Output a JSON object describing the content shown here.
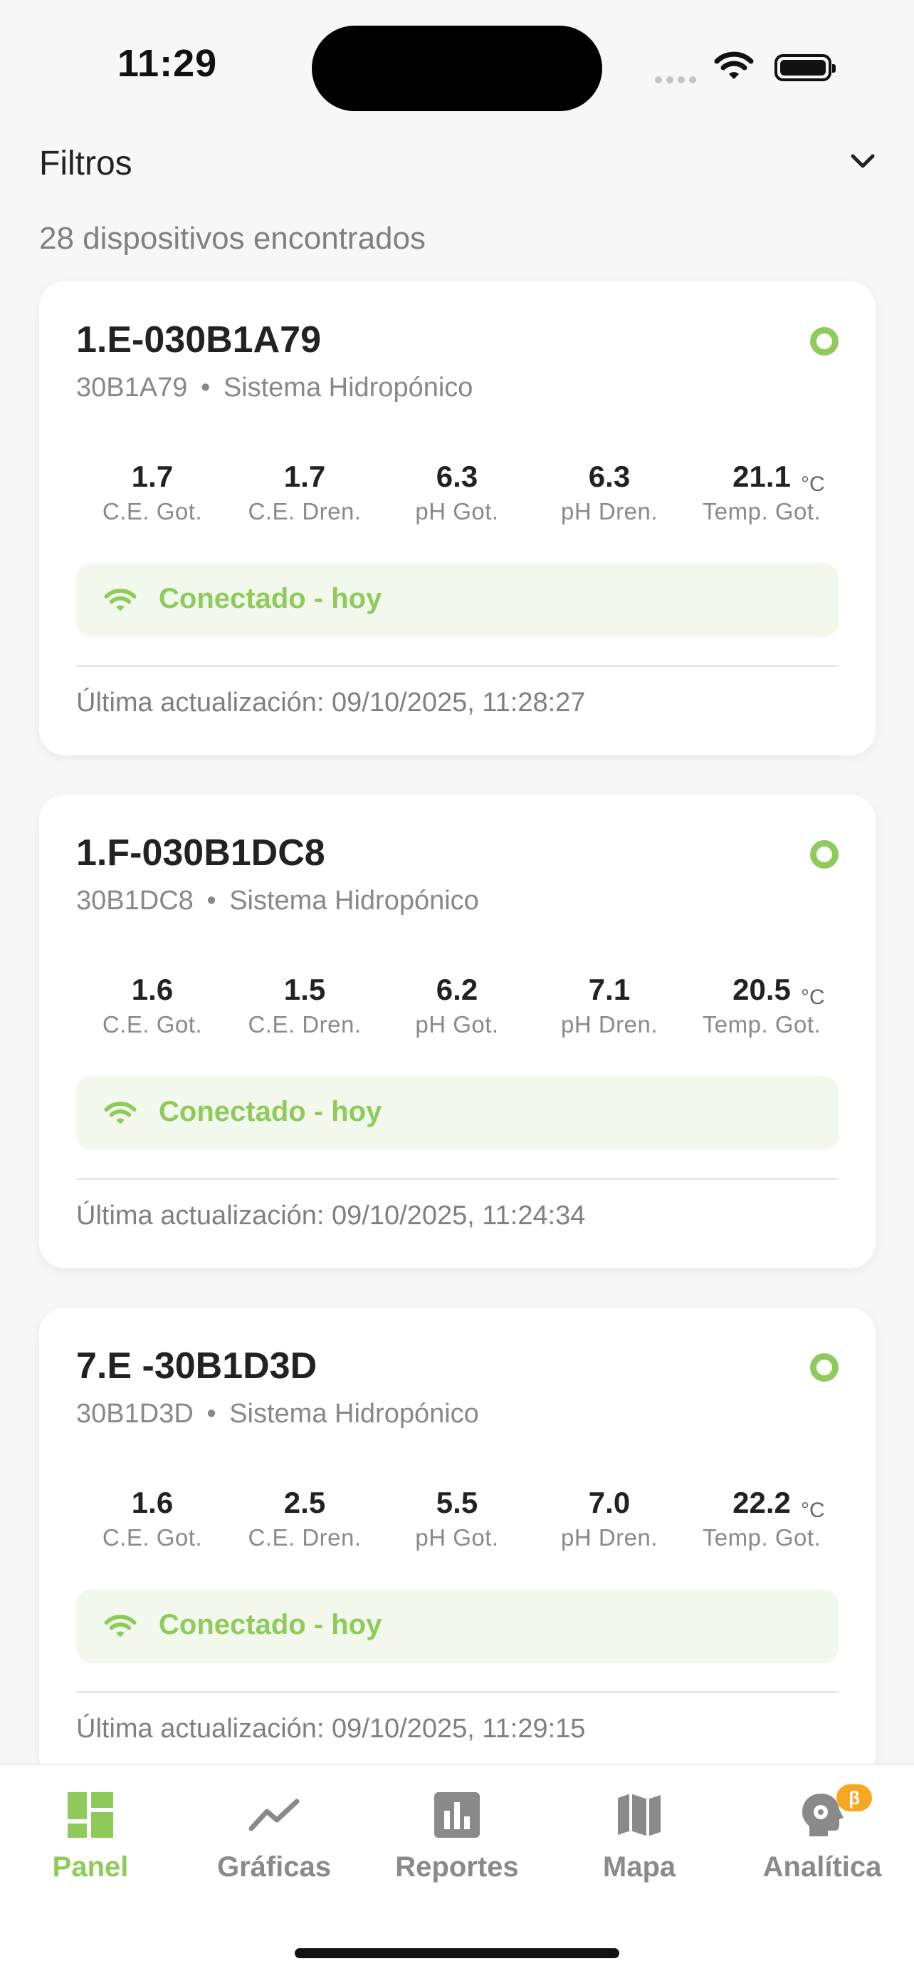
{
  "status_bar": {
    "time": "11:29"
  },
  "header": {
    "filters_title": "Filtros",
    "device_count": "28 dispositivos encontrados"
  },
  "colors": {
    "accent": "#8fcb5a",
    "connection_bg": "#f2f8ec",
    "beta": "#f6a823"
  },
  "devices": [
    {
      "name": "1.E-030B1A79",
      "code": "30B1A79",
      "separator": "•",
      "system": "Sistema Hidropónico",
      "metrics": [
        {
          "value": "1.7",
          "label": "C.E. Got."
        },
        {
          "value": "1.7",
          "label": "C.E. Dren."
        },
        {
          "value": "6.3",
          "label": "pH Got."
        },
        {
          "value": "6.3",
          "label": "pH Dren."
        },
        {
          "value": "21.1",
          "unit": "°C",
          "label": "Temp. Got."
        }
      ],
      "connection": "Conectado - hoy",
      "updated": "Última actualización: 09/10/2025, 11:28:27"
    },
    {
      "name": "1.F-030B1DC8",
      "code": "30B1DC8",
      "separator": "•",
      "system": "Sistema Hidropónico",
      "metrics": [
        {
          "value": "1.6",
          "label": "C.E. Got."
        },
        {
          "value": "1.5",
          "label": "C.E. Dren."
        },
        {
          "value": "6.2",
          "label": "pH Got."
        },
        {
          "value": "7.1",
          "label": "pH Dren."
        },
        {
          "value": "20.5",
          "unit": "°C",
          "label": "Temp. Got."
        }
      ],
      "connection": "Conectado - hoy",
      "updated": "Última actualización: 09/10/2025, 11:24:34"
    },
    {
      "name": "7.E -30B1D3D",
      "code": "30B1D3D",
      "separator": "•",
      "system": "Sistema Hidropónico",
      "metrics": [
        {
          "value": "1.6",
          "label": "C.E. Got."
        },
        {
          "value": "2.5",
          "label": "C.E. Dren."
        },
        {
          "value": "5.5",
          "label": "pH Got."
        },
        {
          "value": "7.0",
          "label": "pH Dren."
        },
        {
          "value": "22.2",
          "unit": "°C",
          "label": "Temp. Got."
        }
      ],
      "connection": "Conectado - hoy",
      "updated": "Última actualización: 09/10/2025, 11:29:15"
    }
  ],
  "tabs": [
    {
      "label": "Panel",
      "icon": "dashboard-icon",
      "active": true
    },
    {
      "label": "Gráficas",
      "icon": "trend-line-icon",
      "active": false
    },
    {
      "label": "Reportes",
      "icon": "bar-report-icon",
      "active": false
    },
    {
      "label": "Mapa",
      "icon": "map-icon",
      "active": false
    },
    {
      "label": "Analítica",
      "icon": "brain-gear-icon",
      "active": false,
      "badge": "β"
    }
  ]
}
